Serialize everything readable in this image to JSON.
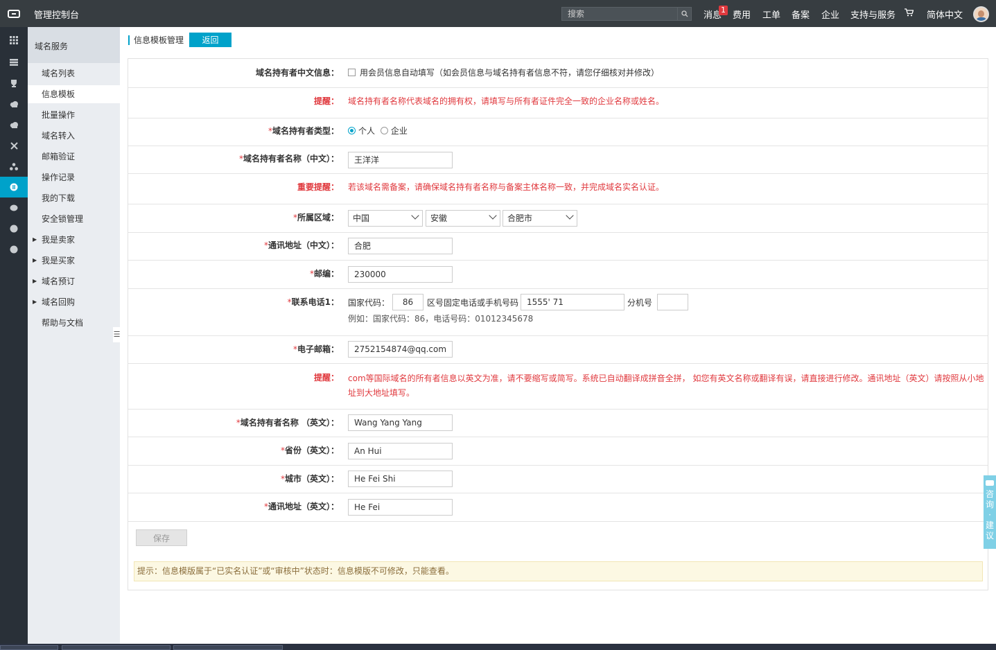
{
  "topbar": {
    "app_title": "管理控制台",
    "search_placeholder": "搜索",
    "nav": {
      "messages": "消息",
      "message_count": "1",
      "billing": "费用",
      "tickets": "工单",
      "filing": "备案",
      "enterprise": "企业",
      "support": "支持与服务",
      "language": "简体中文"
    },
    "icons": {
      "logo": "console-logo-icon",
      "search": "search-icon",
      "cart": "cart-icon",
      "avatar": "user-avatar"
    }
  },
  "rail": {
    "active_index": 7
  },
  "sidebar": {
    "header": "域名服务",
    "items": [
      "域名列表",
      "信息模板",
      "批量操作",
      "域名转入",
      "邮箱验证",
      "操作记录",
      "我的下载",
      "安全锁管理",
      "我是卖家",
      "我是买家",
      "域名预订",
      "域名回购",
      "帮助与文档"
    ],
    "active": "信息模板"
  },
  "breadcrumb": {
    "title": "信息模板管理",
    "back_label": "返回"
  },
  "form": {
    "cn_info": {
      "label": "域名持有者中文信息：",
      "checkbox_label": "用会员信息自动填写（如会员信息与域名持有者信息不符，请您仔细核对并修改）"
    },
    "tip1": {
      "label": "提醒：",
      "text": "域名持有者名称代表域名的拥有权，请填写与所有者证件完全一致的企业名称或姓名。"
    },
    "owner_type": {
      "label": "域名持有者类型：",
      "options": [
        "个人",
        "企业"
      ],
      "selected": "个人"
    },
    "owner_name_cn": {
      "label": "域名持有者名称（中文）：",
      "value": "王洋洋"
    },
    "tip2": {
      "label": "重要提醒：",
      "text": "若该域名需备案，请确保域名持有者名称与备案主体名称一致，并完成域名实名认证。"
    },
    "region": {
      "label": "所属区域：",
      "country": "中国",
      "province": "安徽",
      "city": "合肥市"
    },
    "address_cn": {
      "label": "通讯地址（中文）：",
      "value": "合肥"
    },
    "postcode": {
      "label": "邮编：",
      "value": "230000"
    },
    "phone": {
      "label": "联系电话1：",
      "country_code_label": "国家代码：",
      "country_code": "86",
      "number_label": "区号固定电话或手机号码",
      "number": "1555'        71",
      "ext_label": "分机号",
      "ext": "",
      "example": "例如：国家代码：86，电话号码：01012345678"
    },
    "email": {
      "label": "电子邮箱：",
      "value": "2752154874@qq.com"
    },
    "tip3": {
      "label": "提醒：",
      "text_line1": "com等国际域名的所有者信息以英文为准，请不要缩写或简写。系统已自动翻译成拼音全拼， 如您有英文名称或翻译有误，请直接进行修改。通讯地址（英文）请按照从小地",
      "text_line2": "址到大地址填写。"
    },
    "owner_name_en": {
      "label": "域名持有者名称 （英文）：",
      "value": "Wang Yang Yang"
    },
    "province_en": {
      "label": "省份（英文）：",
      "value": "An Hui"
    },
    "city_en": {
      "label": "城市（英文）：",
      "value": "He Fei Shi"
    },
    "address_en": {
      "label": "通讯地址（英文）：",
      "value": "He Fei"
    },
    "save_label": "保存",
    "hint": "提示：信息模版属于“已实名认证”或“审核中”状态时：信息模版不可修改，只能查看。"
  },
  "feedback_tab": [
    "咨",
    "询",
    "·",
    "建",
    "议"
  ],
  "colors": {
    "accent": "#00a2ca",
    "topbar": "#373d41",
    "rail": "#293038",
    "sidebar": "#eaedf1",
    "warning_red": "#e0393e"
  }
}
